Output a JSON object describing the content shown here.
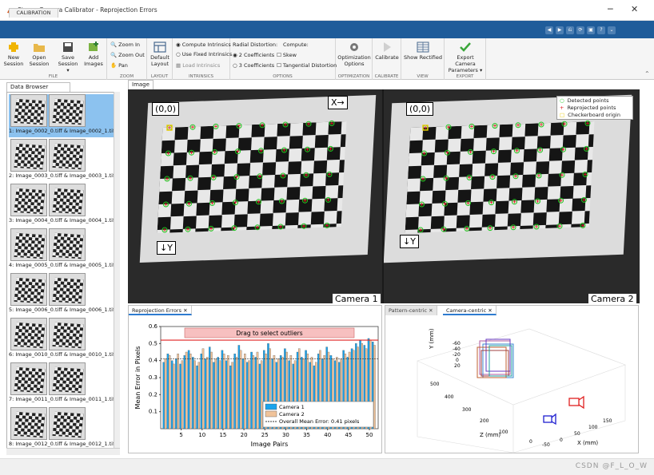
{
  "window": {
    "title": "Stereo Camera Calibrator - Reprojection Errors",
    "minimize": "─",
    "maximize": "☐",
    "close": "✕"
  },
  "ribbon_tab": "CALIBRATION",
  "quick_access": [
    "◀",
    "▶",
    "⎌",
    "⟳",
    "▣",
    "?",
    "⌄"
  ],
  "ribbon": {
    "file": {
      "label": "FILE",
      "new_session": [
        "New",
        "Session"
      ],
      "open_session": [
        "Open",
        "Session"
      ],
      "save_session": [
        "Save",
        "Session ▾"
      ],
      "add_images": [
        "Add",
        "Images"
      ]
    },
    "zoom": {
      "label": "ZOOM",
      "zoom_in": "Zoom In",
      "zoom_out": "Zoom Out",
      "pan": "Pan"
    },
    "layout": {
      "label": "LAYOUT",
      "default_layout": [
        "Default",
        "Layout"
      ]
    },
    "intrinsics": {
      "label": "INTRINSICS",
      "compute": "Compute Intrinsics",
      "use_fixed": "Use Fixed Intrinsics",
      "load": "Load Intrinsics"
    },
    "options": {
      "label": "OPTIONS",
      "radial_title": "Radial Distortion:",
      "compute_title": "Compute:",
      "two_coeff": "2 Coefficients",
      "three_coeff": "3 Coefficients",
      "skew": "Skew",
      "tangential": "Tangential Distortion"
    },
    "optimization": {
      "label": "OPTIMIZATION",
      "button": [
        "Optimization",
        "Options"
      ]
    },
    "calibrate": {
      "label": "CALIBRATE",
      "button": "Calibrate"
    },
    "view": {
      "label": "VIEW",
      "button": "Show Rectified"
    },
    "export": {
      "label": "EXPORT",
      "button": [
        "Export Camera",
        "Parameters ▾"
      ]
    }
  },
  "data_browser": {
    "title": "Data Browser",
    "items": [
      "1: Image_0002_0.tiff & Image_0002_1.tiff",
      "2: Image_0003_0.tiff & Image_0003_1.tiff",
      "3: Image_0004_0.tiff & Image_0004_1.tiff",
      "4: Image_0005_0.tiff & Image_0005_1.tiff",
      "5: Image_0006_0.tiff & Image_0006_1.tiff",
      "6: Image_0010_0.tiff & Image_0010_1.tiff",
      "7: Image_0011_0.tiff & Image_0011_1.tiff",
      "8: Image_0012_0.tiff & Image_0012_1.tiff"
    ]
  },
  "image_panel": {
    "title": "Image",
    "origin_label": "(0,0)",
    "x_label": "X→",
    "y_label": "↓Y",
    "camera1": "Camera 1",
    "camera2": "Camera 2",
    "legend": [
      "Detected points",
      "Reprojected points",
      "Checkerboard origin"
    ]
  },
  "reprojection_panel": {
    "tab": "Reprojection Errors",
    "drag_text": "Drag to select outliers",
    "mean_error_label": "Overall Mean Error: 0.41 pixels"
  },
  "extrinsics_panel": {
    "tab_pattern": "Pattern-centric",
    "tab_camera": "Camera-centric",
    "zlabel": "Z (mm)",
    "xlabel": "X (mm)",
    "ylabel": "Y (mm)",
    "z_ticks": [
      "500",
      "400",
      "300",
      "200",
      "100",
      "0"
    ],
    "x_ticks": [
      "-50",
      "0",
      "50",
      "100",
      "150"
    ],
    "y_ticks": [
      "-60",
      "-40",
      "-20",
      "0",
      "20"
    ]
  },
  "watermark": "CSDN @F_L_O_W",
  "colors": {
    "cam1": "#1aa3ec",
    "cam2": "#f0c39a",
    "mean_line": "#e02020",
    "drag_box": "#f7c0c0",
    "accent": "#1f5c9a"
  },
  "chart_data": {
    "type": "bar",
    "xlabel": "Image Pairs",
    "ylabel": "Mean Error in Pixels",
    "ylim": [
      0,
      0.6
    ],
    "yticks": [
      0.1,
      0.2,
      0.3,
      0.4,
      0.5,
      0.6
    ],
    "xticks": [
      5,
      10,
      15,
      20,
      25,
      30,
      35,
      40,
      45,
      50
    ],
    "mean": 0.41,
    "series": [
      {
        "name": "Camera 1",
        "values": [
          0.39,
          0.44,
          0.4,
          0.41,
          0.38,
          0.43,
          0.46,
          0.42,
          0.37,
          0.44,
          0.41,
          0.48,
          0.39,
          0.42,
          0.46,
          0.4,
          0.37,
          0.44,
          0.49,
          0.41,
          0.39,
          0.45,
          0.42,
          0.38,
          0.46,
          0.5,
          0.41,
          0.39,
          0.43,
          0.47,
          0.4,
          0.38,
          0.45,
          0.42,
          0.46,
          0.39,
          0.37,
          0.44,
          0.41,
          0.48,
          0.43,
          0.4,
          0.39,
          0.46,
          0.42,
          0.47,
          0.5,
          0.52,
          0.49,
          0.53,
          0.51
        ]
      },
      {
        "name": "Camera 2",
        "values": [
          0.41,
          0.43,
          0.38,
          0.44,
          0.4,
          0.45,
          0.44,
          0.4,
          0.39,
          0.47,
          0.42,
          0.45,
          0.41,
          0.4,
          0.44,
          0.43,
          0.39,
          0.42,
          0.46,
          0.44,
          0.4,
          0.43,
          0.45,
          0.4,
          0.44,
          0.47,
          0.43,
          0.41,
          0.42,
          0.45,
          0.43,
          0.4,
          0.47,
          0.41,
          0.44,
          0.42,
          0.39,
          0.46,
          0.43,
          0.45,
          0.41,
          0.42,
          0.41,
          0.44,
          0.45,
          0.46,
          0.48,
          0.5,
          0.47,
          0.52,
          0.49
        ]
      }
    ]
  }
}
